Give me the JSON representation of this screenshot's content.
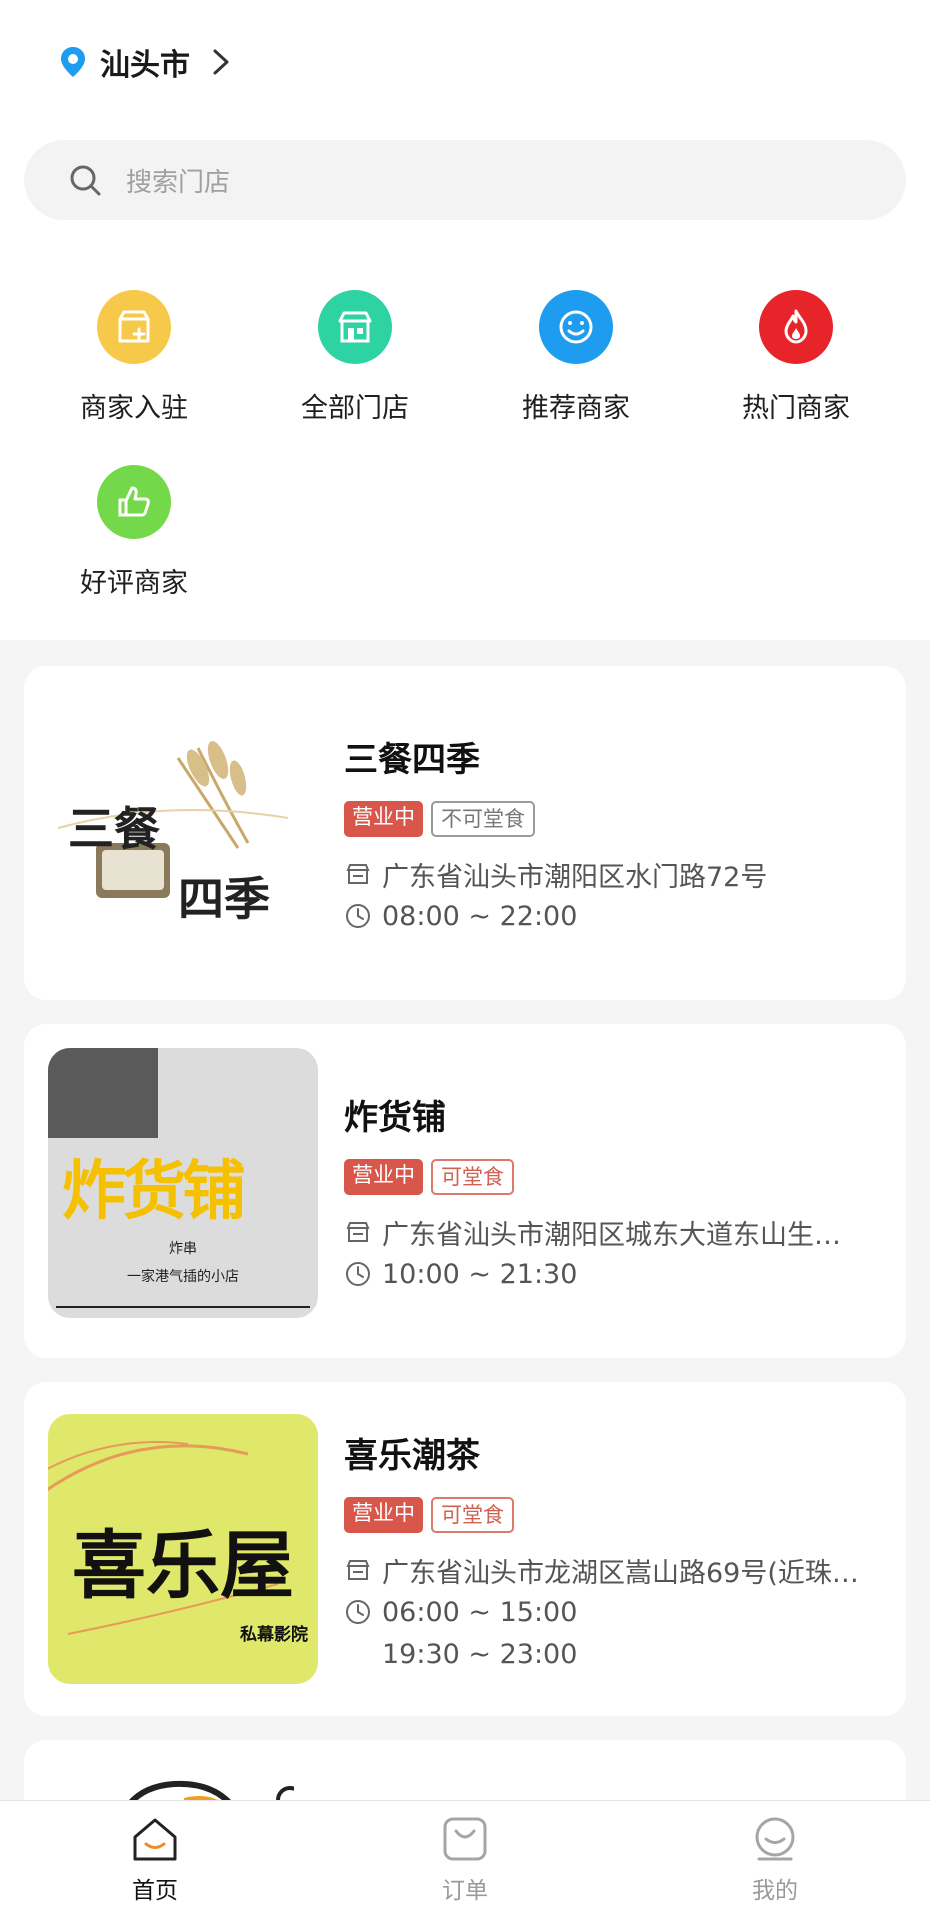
{
  "header": {
    "city": "汕头市"
  },
  "search": {
    "placeholder": "搜索门店"
  },
  "categories": [
    {
      "label": "商家入驻",
      "icon": "store-add-icon",
      "color": "#f7c94a"
    },
    {
      "label": "全部门店",
      "icon": "storefront-icon",
      "color": "#2ed3a3"
    },
    {
      "label": "推荐商家",
      "icon": "smile-icon",
      "color": "#1e9cf0"
    },
    {
      "label": "热门商家",
      "icon": "flame-icon",
      "color": "#e8242b"
    },
    {
      "label": "好评商家",
      "icon": "thumbs-up-icon",
      "color": "#74d94a"
    }
  ],
  "shops": [
    {
      "name": "三餐四季",
      "status": "营业中",
      "dine": "不可堂食",
      "address": "广东省汕头市潮阳区水门路72号",
      "hours": [
        "08:00 ~ 22:00"
      ],
      "logo_text": [
        "三餐",
        "四季"
      ]
    },
    {
      "name": "炸货铺",
      "status": "营业中",
      "dine": "可堂食",
      "address": "广东省汕头市潮阳区城东大道东山生…",
      "hours": [
        "10:00 ~ 21:30"
      ],
      "logo_text": [
        "炸货铺",
        "炸串",
        "一家港气插的小店"
      ]
    },
    {
      "name": "喜乐潮茶",
      "status": "营业中",
      "dine": "可堂食",
      "address": "广东省汕头市龙湖区嵩山路69号(近珠…",
      "hours": [
        "06:00 ~ 15:00",
        "19:30 ~ 23:00"
      ],
      "logo_text": [
        "喜乐屋",
        "私幕影院"
      ]
    }
  ],
  "tabs": [
    {
      "label": "首页",
      "icon": "home-icon",
      "active": true
    },
    {
      "label": "订单",
      "icon": "bag-icon",
      "active": false
    },
    {
      "label": "我的",
      "icon": "profile-icon",
      "active": false
    }
  ],
  "colors": {
    "open_tag": "#d9574a",
    "accent_pin": "#1e9cf0"
  }
}
